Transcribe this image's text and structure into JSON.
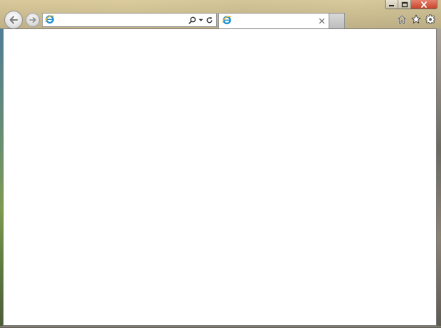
{
  "window": {
    "caption_buttons": {
      "minimize_icon": "minimize-icon",
      "restore_icon": "restore-icon",
      "close_icon": "close-icon"
    }
  },
  "navigation": {
    "back_icon": "back-arrow-icon",
    "forward_icon": "forward-arrow-icon"
  },
  "address_bar": {
    "value": "",
    "placeholder": "",
    "site_icon": "ie-icon",
    "search_icon": "search-icon",
    "dropdown_icon": "chevron-down-icon",
    "refresh_icon": "refresh-icon"
  },
  "tabs": [
    {
      "title": "",
      "icon": "ie-icon",
      "close_label": "×"
    }
  ],
  "toolbar": {
    "home_icon": "home-icon",
    "favorites_icon": "star-icon",
    "tools_icon": "gear-icon"
  },
  "colors": {
    "close_button": "#c7432b",
    "content_background": "#ffffff",
    "ie_blue": "#1e8fd6",
    "ie_ring": "#f1b82d"
  }
}
